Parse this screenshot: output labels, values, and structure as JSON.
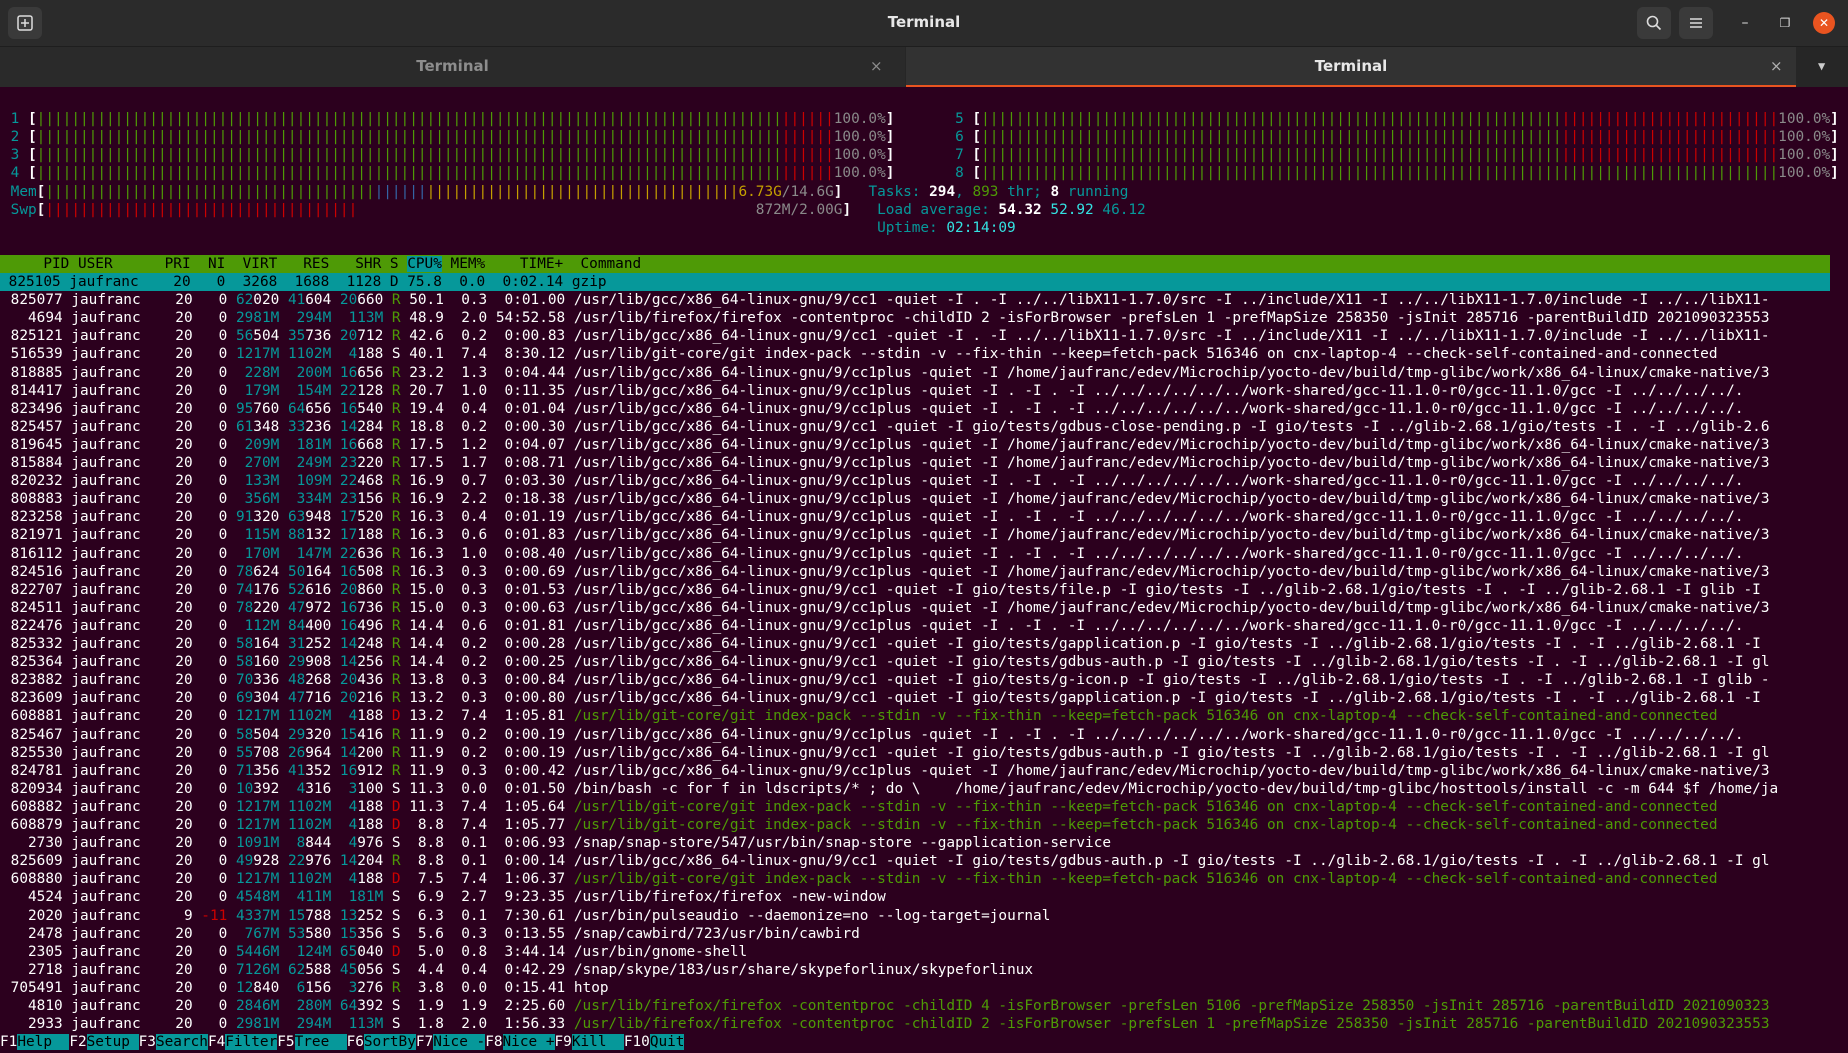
{
  "window": {
    "title": "Terminal"
  },
  "tabs": [
    {
      "label": "Terminal",
      "active": false
    },
    {
      "label": "Terminal",
      "active": true
    }
  ],
  "icons": {
    "close": "×",
    "dropdown": "▼",
    "minimize": "–",
    "maximize": "❐",
    "window_close": "✕"
  },
  "meters": {
    "cpu_left": [
      {
        "id": "1",
        "pct": "100.0%"
      },
      {
        "id": "2",
        "pct": "100.0%"
      },
      {
        "id": "3",
        "pct": "100.0%"
      },
      {
        "id": "4",
        "pct": "100.0%"
      }
    ],
    "cpu_right": [
      {
        "id": "5",
        "pct": "100.0%"
      },
      {
        "id": "6",
        "pct": "100.0%"
      },
      {
        "id": "7",
        "pct": "100.0%"
      },
      {
        "id": "8",
        "pct": "100.0%"
      }
    ],
    "mem": {
      "label": "Mem",
      "used": "6.73G",
      "total": "14.6G"
    },
    "swap": {
      "label": "Swp",
      "value": "872M/2.00G"
    },
    "tasks": {
      "label": "Tasks:",
      "count": "294",
      "threads": "893",
      "thr_label": "thr;",
      "running": "8",
      "running_label": "running"
    },
    "load": {
      "label": "Load average:",
      "v1": "54.32",
      "v5": "52.92",
      "v15": "46.12"
    },
    "uptime": {
      "label": "Uptime:",
      "value": "02:14:09"
    }
  },
  "table": {
    "headers": {
      "pid": "PID",
      "user": "USER",
      "pri": "PRI",
      "ni": "NI",
      "virt": "VIRT",
      "res": "RES",
      "shr": "SHR",
      "s": "S",
      "cpu": "CPU%",
      "mem": "MEM%",
      "time": "TIME+",
      "command": "Command"
    },
    "rows": [
      [
        "825105",
        "jaufranc",
        "20",
        "0",
        "3268",
        "1688",
        "1128",
        "D",
        "75.8",
        "0.0",
        "0:02.14",
        "gzip"
      ],
      [
        "825077",
        "jaufranc",
        "20",
        "0",
        "62020",
        "41604",
        "20660",
        "R",
        "50.1",
        "0.3",
        "0:01.00",
        "/usr/lib/gcc/x86_64-linux-gnu/9/cc1 -quiet -I . -I ../../libX11-1.7.0/src -I ../include/X11 -I ../../libX11-1.7.0/include -I ../../libX11-"
      ],
      [
        "4694",
        "jaufranc",
        "20",
        "0",
        "2981M",
        "294M",
        "113M",
        "R",
        "48.9",
        "2.0",
        "54:52.58",
        "/usr/lib/firefox/firefox -contentproc -childID 2 -isForBrowser -prefsLen 1 -prefMapSize 258350 -jsInit 285716 -parentBuildID 2021090323553"
      ],
      [
        "825121",
        "jaufranc",
        "20",
        "0",
        "56504",
        "35736",
        "20712",
        "R",
        "42.6",
        "0.2",
        "0:00.83",
        "/usr/lib/gcc/x86_64-linux-gnu/9/cc1 -quiet -I . -I ../../libX11-1.7.0/src -I ../include/X11 -I ../../libX11-1.7.0/include -I ../../libX11-"
      ],
      [
        "516539",
        "jaufranc",
        "20",
        "0",
        "1217M",
        "1102M",
        "4188",
        "S",
        "40.1",
        "7.4",
        "8:30.12",
        "/usr/lib/git-core/git index-pack --stdin -v --fix-thin --keep=fetch-pack 516346 on cnx-laptop-4 --check-self-contained-and-connected"
      ],
      [
        "818885",
        "jaufranc",
        "20",
        "0",
        "228M",
        "200M",
        "16656",
        "R",
        "23.2",
        "1.3",
        "0:04.44",
        "/usr/lib/gcc/x86_64-linux-gnu/9/cc1plus -quiet -I /home/jaufranc/edev/Microchip/yocto-dev/build/tmp-glibc/work/x86_64-linux/cmake-native/3"
      ],
      [
        "814417",
        "jaufranc",
        "20",
        "0",
        "179M",
        "154M",
        "22128",
        "R",
        "20.7",
        "1.0",
        "0:11.35",
        "/usr/lib/gcc/x86_64-linux-gnu/9/cc1plus -quiet -I . -I . -I ../../../../../../work-shared/gcc-11.1.0-r0/gcc-11.1.0/gcc -I ../../../../."
      ],
      [
        "823496",
        "jaufranc",
        "20",
        "0",
        "95760",
        "64656",
        "16540",
        "R",
        "19.4",
        "0.4",
        "0:01.04",
        "/usr/lib/gcc/x86_64-linux-gnu/9/cc1plus -quiet -I . -I . -I ../../../../../../work-shared/gcc-11.1.0-r0/gcc-11.1.0/gcc -I ../../../../."
      ],
      [
        "825457",
        "jaufranc",
        "20",
        "0",
        "61348",
        "33236",
        "14284",
        "R",
        "18.8",
        "0.2",
        "0:00.30",
        "/usr/lib/gcc/x86_64-linux-gnu/9/cc1 -quiet -I gio/tests/gdbus-close-pending.p -I gio/tests -I ../glib-2.68.1/gio/tests -I . -I ../glib-2.6"
      ],
      [
        "819645",
        "jaufranc",
        "20",
        "0",
        "209M",
        "181M",
        "16668",
        "R",
        "17.5",
        "1.2",
        "0:04.07",
        "/usr/lib/gcc/x86_64-linux-gnu/9/cc1plus -quiet -I /home/jaufranc/edev/Microchip/yocto-dev/build/tmp-glibc/work/x86_64-linux/cmake-native/3"
      ],
      [
        "815884",
        "jaufranc",
        "20",
        "0",
        "270M",
        "249M",
        "23220",
        "R",
        "17.5",
        "1.7",
        "0:08.71",
        "/usr/lib/gcc/x86_64-linux-gnu/9/cc1plus -quiet -I /home/jaufranc/edev/Microchip/yocto-dev/build/tmp-glibc/work/x86_64-linux/cmake-native/3"
      ],
      [
        "820232",
        "jaufranc",
        "20",
        "0",
        "133M",
        "109M",
        "22468",
        "R",
        "16.9",
        "0.7",
        "0:03.30",
        "/usr/lib/gcc/x86_64-linux-gnu/9/cc1plus -quiet -I . -I . -I ../../../../../../work-shared/gcc-11.1.0-r0/gcc-11.1.0/gcc -I ../../../../."
      ],
      [
        "808883",
        "jaufranc",
        "20",
        "0",
        "356M",
        "334M",
        "23156",
        "R",
        "16.9",
        "2.2",
        "0:18.38",
        "/usr/lib/gcc/x86_64-linux-gnu/9/cc1plus -quiet -I /home/jaufranc/edev/Microchip/yocto-dev/build/tmp-glibc/work/x86_64-linux/cmake-native/3"
      ],
      [
        "823258",
        "jaufranc",
        "20",
        "0",
        "91320",
        "63948",
        "17520",
        "R",
        "16.3",
        "0.4",
        "0:01.19",
        "/usr/lib/gcc/x86_64-linux-gnu/9/cc1plus -quiet -I . -I . -I ../../../../../../work-shared/gcc-11.1.0-r0/gcc-11.1.0/gcc -I ../../../../."
      ],
      [
        "821971",
        "jaufranc",
        "20",
        "0",
        "115M",
        "88132",
        "17188",
        "R",
        "16.3",
        "0.6",
        "0:01.83",
        "/usr/lib/gcc/x86_64-linux-gnu/9/cc1plus -quiet -I /home/jaufranc/edev/Microchip/yocto-dev/build/tmp-glibc/work/x86_64-linux/cmake-native/3"
      ],
      [
        "816112",
        "jaufranc",
        "20",
        "0",
        "170M",
        "147M",
        "22636",
        "R",
        "16.3",
        "1.0",
        "0:08.40",
        "/usr/lib/gcc/x86_64-linux-gnu/9/cc1plus -quiet -I . -I . -I ../../../../../../work-shared/gcc-11.1.0-r0/gcc-11.1.0/gcc -I ../../../../."
      ],
      [
        "824516",
        "jaufranc",
        "20",
        "0",
        "78624",
        "50164",
        "16508",
        "R",
        "16.3",
        "0.3",
        "0:00.69",
        "/usr/lib/gcc/x86_64-linux-gnu/9/cc1plus -quiet -I /home/jaufranc/edev/Microchip/yocto-dev/build/tmp-glibc/work/x86_64-linux/cmake-native/3"
      ],
      [
        "822707",
        "jaufranc",
        "20",
        "0",
        "74176",
        "52616",
        "20860",
        "R",
        "15.0",
        "0.3",
        "0:01.53",
        "/usr/lib/gcc/x86_64-linux-gnu/9/cc1 -quiet -I gio/tests/file.p -I gio/tests -I ../glib-2.68.1/gio/tests -I . -I ../glib-2.68.1 -I glib -I"
      ],
      [
        "824511",
        "jaufranc",
        "20",
        "0",
        "78220",
        "47972",
        "16736",
        "R",
        "15.0",
        "0.3",
        "0:00.63",
        "/usr/lib/gcc/x86_64-linux-gnu/9/cc1plus -quiet -I /home/jaufranc/edev/Microchip/yocto-dev/build/tmp-glibc/work/x86_64-linux/cmake-native/3"
      ],
      [
        "822476",
        "jaufranc",
        "20",
        "0",
        "112M",
        "84400",
        "16496",
        "R",
        "14.4",
        "0.6",
        "0:01.81",
        "/usr/lib/gcc/x86_64-linux-gnu/9/cc1plus -quiet -I . -I . -I ../../../../../../work-shared/gcc-11.1.0-r0/gcc-11.1.0/gcc -I ../../../../."
      ],
      [
        "825332",
        "jaufranc",
        "20",
        "0",
        "58164",
        "31252",
        "14248",
        "R",
        "14.4",
        "0.2",
        "0:00.28",
        "/usr/lib/gcc/x86_64-linux-gnu/9/cc1 -quiet -I gio/tests/gapplication.p -I gio/tests -I ../glib-2.68.1/gio/tests -I . -I ../glib-2.68.1 -I"
      ],
      [
        "825364",
        "jaufranc",
        "20",
        "0",
        "58160",
        "29908",
        "14256",
        "R",
        "14.4",
        "0.2",
        "0:00.25",
        "/usr/lib/gcc/x86_64-linux-gnu/9/cc1 -quiet -I gio/tests/gdbus-auth.p -I gio/tests -I ../glib-2.68.1/gio/tests -I . -I ../glib-2.68.1 -I gl"
      ],
      [
        "823882",
        "jaufranc",
        "20",
        "0",
        "70336",
        "48268",
        "20436",
        "R",
        "13.8",
        "0.3",
        "0:00.84",
        "/usr/lib/gcc/x86_64-linux-gnu/9/cc1 -quiet -I gio/tests/g-icon.p -I gio/tests -I ../glib-2.68.1/gio/tests -I . -I ../glib-2.68.1 -I glib -"
      ],
      [
        "823609",
        "jaufranc",
        "20",
        "0",
        "69304",
        "47716",
        "20216",
        "R",
        "13.2",
        "0.3",
        "0:00.80",
        "/usr/lib/gcc/x86_64-linux-gnu/9/cc1 -quiet -I gio/tests/gapplication.p -I gio/tests -I ../glib-2.68.1/gio/tests -I . -I ../glib-2.68.1 -I"
      ],
      [
        "608881",
        "jaufranc",
        "20",
        "0",
        "1217M",
        "1102M",
        "4188",
        "D",
        "13.2",
        "7.4",
        "1:05.81",
        "/usr/lib/git-core/git index-pack --stdin -v --fix-thin --keep=fetch-pack 516346 on cnx-laptop-4 --check-self-contained-and-connected"
      ],
      [
        "825467",
        "jaufranc",
        "20",
        "0",
        "58504",
        "29320",
        "15416",
        "R",
        "11.9",
        "0.2",
        "0:00.19",
        "/usr/lib/gcc/x86_64-linux-gnu/9/cc1plus -quiet -I . -I . -I ../../../../../../work-shared/gcc-11.1.0-r0/gcc-11.1.0/gcc -I ../../../../."
      ],
      [
        "825530",
        "jaufranc",
        "20",
        "0",
        "55708",
        "26964",
        "14200",
        "R",
        "11.9",
        "0.2",
        "0:00.19",
        "/usr/lib/gcc/x86_64-linux-gnu/9/cc1 -quiet -I gio/tests/gdbus-auth.p -I gio/tests -I ../glib-2.68.1/gio/tests -I . -I ../glib-2.68.1 -I gl"
      ],
      [
        "824781",
        "jaufranc",
        "20",
        "0",
        "71356",
        "41352",
        "16912",
        "R",
        "11.9",
        "0.3",
        "0:00.42",
        "/usr/lib/gcc/x86_64-linux-gnu/9/cc1plus -quiet -I /home/jaufranc/edev/Microchip/yocto-dev/build/tmp-glibc/work/x86_64-linux/cmake-native/3"
      ],
      [
        "820934",
        "jaufranc",
        "20",
        "0",
        "10392",
        "4316",
        "3100",
        "S",
        "11.3",
        "0.0",
        "0:01.50",
        "/bin/bash -c for f in ldscripts/* ; do \\    /home/jaufranc/edev/Microchip/yocto-dev/build/tmp-glibc/hosttools/install -c -m 644 $f /home/ja"
      ],
      [
        "608882",
        "jaufranc",
        "20",
        "0",
        "1217M",
        "1102M",
        "4188",
        "D",
        "11.3",
        "7.4",
        "1:05.64",
        "/usr/lib/git-core/git index-pack --stdin -v --fix-thin --keep=fetch-pack 516346 on cnx-laptop-4 --check-self-contained-and-connected"
      ],
      [
        "608879",
        "jaufranc",
        "20",
        "0",
        "1217M",
        "1102M",
        "4188",
        "D",
        "8.8",
        "7.4",
        "1:05.77",
        "/usr/lib/git-core/git index-pack --stdin -v --fix-thin --keep=fetch-pack 516346 on cnx-laptop-4 --check-self-contained-and-connected"
      ],
      [
        "2730",
        "jaufranc",
        "20",
        "0",
        "1091M",
        "8844",
        "4976",
        "S",
        "8.8",
        "0.1",
        "0:06.93",
        "/snap/snap-store/547/usr/bin/snap-store --gapplication-service"
      ],
      [
        "825609",
        "jaufranc",
        "20",
        "0",
        "49928",
        "22976",
        "14204",
        "R",
        "8.8",
        "0.1",
        "0:00.14",
        "/usr/lib/gcc/x86_64-linux-gnu/9/cc1 -quiet -I gio/tests/gdbus-auth.p -I gio/tests -I ../glib-2.68.1/gio/tests -I . -I ../glib-2.68.1 -I gl"
      ],
      [
        "608880",
        "jaufranc",
        "20",
        "0",
        "1217M",
        "1102M",
        "4188",
        "D",
        "7.5",
        "7.4",
        "1:06.37",
        "/usr/lib/git-core/git index-pack --stdin -v --fix-thin --keep=fetch-pack 516346 on cnx-laptop-4 --check-self-contained-and-connected"
      ],
      [
        "4524",
        "jaufranc",
        "20",
        "0",
        "4548M",
        "411M",
        "181M",
        "S",
        "6.9",
        "2.7",
        "9:23.35",
        "/usr/lib/firefox/firefox -new-window"
      ],
      [
        "2020",
        "jaufranc",
        "9",
        "-11",
        "4337M",
        "15788",
        "13252",
        "S",
        "6.3",
        "0.1",
        "7:30.61",
        "/usr/bin/pulseaudio --daemonize=no --log-target=journal"
      ],
      [
        "2478",
        "jaufranc",
        "20",
        "0",
        "767M",
        "53580",
        "15356",
        "S",
        "5.6",
        "0.3",
        "0:13.55",
        "/snap/cawbird/723/usr/bin/cawbird"
      ],
      [
        "2305",
        "jaufranc",
        "20",
        "0",
        "5446M",
        "124M",
        "65040",
        "D",
        "5.0",
        "0.8",
        "3:44.14",
        "/usr/bin/gnome-shell"
      ],
      [
        "2718",
        "jaufranc",
        "20",
        "0",
        "7126M",
        "62588",
        "45056",
        "S",
        "4.4",
        "0.4",
        "0:42.29",
        "/snap/skype/183/usr/share/skypeforlinux/skypeforlinux"
      ],
      [
        "705491",
        "jaufranc",
        "20",
        "0",
        "12840",
        "6156",
        "3276",
        "R",
        "3.8",
        "0.0",
        "0:15.41",
        "htop"
      ],
      [
        "4810",
        "jaufranc",
        "20",
        "0",
        "2846M",
        "280M",
        "64392",
        "S",
        "1.9",
        "1.9",
        "2:25.60",
        "/usr/lib/firefox/firefox -contentproc -childID 4 -isForBrowser -prefsLen 5106 -prefMapSize 258350 -jsInit 285716 -parentBuildID 2021090323"
      ],
      [
        "2933",
        "jaufranc",
        "20",
        "0",
        "2981M",
        "294M",
        "113M",
        "S",
        "1.8",
        "2.0",
        "1:56.33",
        "/usr/lib/firefox/firefox -contentproc -childID 2 -isForBrowser -prefsLen 1 -prefMapSize 258350 -jsInit 285716 -parentBuildID 2021090323553"
      ]
    ],
    "thread_rows": [
      24,
      29,
      30,
      33,
      40,
      41
    ]
  },
  "function_keys": [
    {
      "key": "F1",
      "label": "Help  "
    },
    {
      "key": "F2",
      "label": "Setup "
    },
    {
      "key": "F3",
      "label": "Search"
    },
    {
      "key": "F4",
      "label": "Filter"
    },
    {
      "key": "F5",
      "label": "Tree  "
    },
    {
      "key": "F6",
      "label": "SortBy"
    },
    {
      "key": "F7",
      "label": "Nice -"
    },
    {
      "key": "F8",
      "label": "Nice +"
    },
    {
      "key": "F9",
      "label": "Kill  "
    },
    {
      "key": "F10",
      "label": "Quit"
    }
  ]
}
